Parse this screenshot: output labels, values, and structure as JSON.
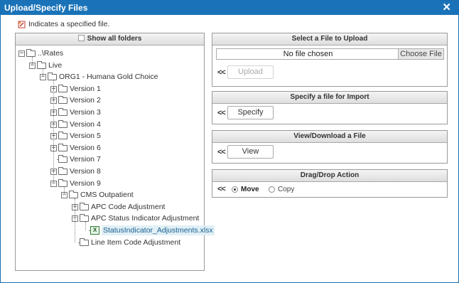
{
  "window": {
    "title": "Upload/Specify Files",
    "close_glyph": "✕"
  },
  "hint": {
    "icon": "specified-file-icon",
    "text": "Indicates a specified file."
  },
  "folders": {
    "show_all_label": "Show all folders",
    "show_all_checked": false,
    "tree": [
      {
        "label": "..\\Rates",
        "expander": "−"
      },
      {
        "label": "Live",
        "expander": "−"
      },
      {
        "label": "ORG1 - Humana Gold Choice",
        "expander": "−"
      },
      {
        "label": "Version 1",
        "expander": "+"
      },
      {
        "label": "Version 2",
        "expander": "+"
      },
      {
        "label": "Version 3",
        "expander": "+"
      },
      {
        "label": "Version 4",
        "expander": "+"
      },
      {
        "label": "Version 5",
        "expander": "+"
      },
      {
        "label": "Version 6",
        "expander": "+"
      },
      {
        "label": "Version 7",
        "expander": ""
      },
      {
        "label": "Version 8",
        "expander": "+"
      },
      {
        "label": "Version 9",
        "expander": "−"
      },
      {
        "label": "CMS Outpatient",
        "expander": "−"
      },
      {
        "label": "APC Code Adjustment",
        "expander": "+"
      },
      {
        "label": "APC Status Indicator Adjustment",
        "expander": "−"
      },
      {
        "label": "StatusIndicator_Adjustments.xlsx",
        "expander": "",
        "icon": "excel-file-icon"
      },
      {
        "label": "Line Item Code Adjustment",
        "expander": ""
      }
    ]
  },
  "upload": {
    "header": "Select a File to Upload",
    "file_status": "No file chosen",
    "choose_label": "Choose File",
    "upload_label": "Upload",
    "upload_enabled": false
  },
  "specify": {
    "header": "Specify a file for Import",
    "button_label": "Specify"
  },
  "view": {
    "header": "View/Download a File",
    "button_label": "View"
  },
  "dragdrop": {
    "header": "Drag/Drop Action",
    "options": [
      {
        "label": "Move",
        "checked": true
      },
      {
        "label": "Copy",
        "checked": false
      }
    ]
  },
  "chevron_glyph": "<<",
  "colors": {
    "title_bar": "#1a73b8",
    "file_highlight": "#e0f0f5",
    "excel_green": "#2e7d32"
  }
}
